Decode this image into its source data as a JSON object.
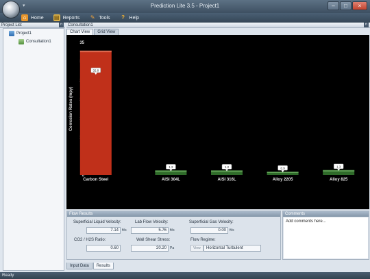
{
  "window": {
    "title": "Prediction Lite 3.5 - Project1"
  },
  "menu": {
    "home": "Home",
    "reports": "Reports",
    "tools": "Tools",
    "help": "Help"
  },
  "project_list": {
    "header": "Project List",
    "project": "Project1",
    "consultation": "Consultation1"
  },
  "consultation": {
    "header": "Consultation1",
    "tabs": {
      "chart_view": "Chart View",
      "grid_view": "Grid View"
    }
  },
  "chart_data": {
    "type": "bar",
    "ylabel": "Corrosion Rates (mpy)",
    "ylim": [
      0,
      35
    ],
    "yticks": [
      "0",
      "5",
      "10",
      "15",
      "20",
      "25",
      "30",
      "35"
    ],
    "categories": [
      "Carbon Steel",
      "AISI 304L",
      "AISI 316L",
      "Alloy 2205",
      "Alloy 825"
    ],
    "values": [
      32.8,
      1.2,
      1.2,
      0.9,
      1.3
    ],
    "data_labels": [
      "32.8",
      "1.2",
      "1.2",
      "0.9",
      "1.3"
    ],
    "colors": [
      "#c0301a",
      "#2f6b2a",
      "#2f6b2a",
      "#2f6b2a",
      "#2f6b2a"
    ]
  },
  "flow_results": {
    "header": "Flow Results",
    "superficial_liquid_velocity": {
      "label": "Superficial Liquid Velocity:",
      "value": "7.14",
      "unit": "ft/s"
    },
    "lab_flow_velocity": {
      "label": "Lab Flow Velocity:",
      "value": "5.76",
      "unit": "ft/s"
    },
    "superficial_gas_velocity": {
      "label": "Superficial Gas Velocity:",
      "value": "0.00",
      "unit": "ft/s"
    },
    "co2_h2s_ratio": {
      "label": "CO2 / H2S Ratio:",
      "value": "0.60"
    },
    "wall_shear_stress": {
      "label": "Wall Shear Stress:",
      "value": "20.20",
      "unit": "Pa"
    },
    "flow_regime": {
      "label": "Flow Regime:",
      "view": "View",
      "value": "Horizontal Turbulent"
    }
  },
  "comments": {
    "header": "Comments",
    "placeholder": "Add comments here..."
  },
  "bottom_tabs": {
    "input_data": "Input Data",
    "results": "Results"
  },
  "status": {
    "text": "Ready"
  }
}
